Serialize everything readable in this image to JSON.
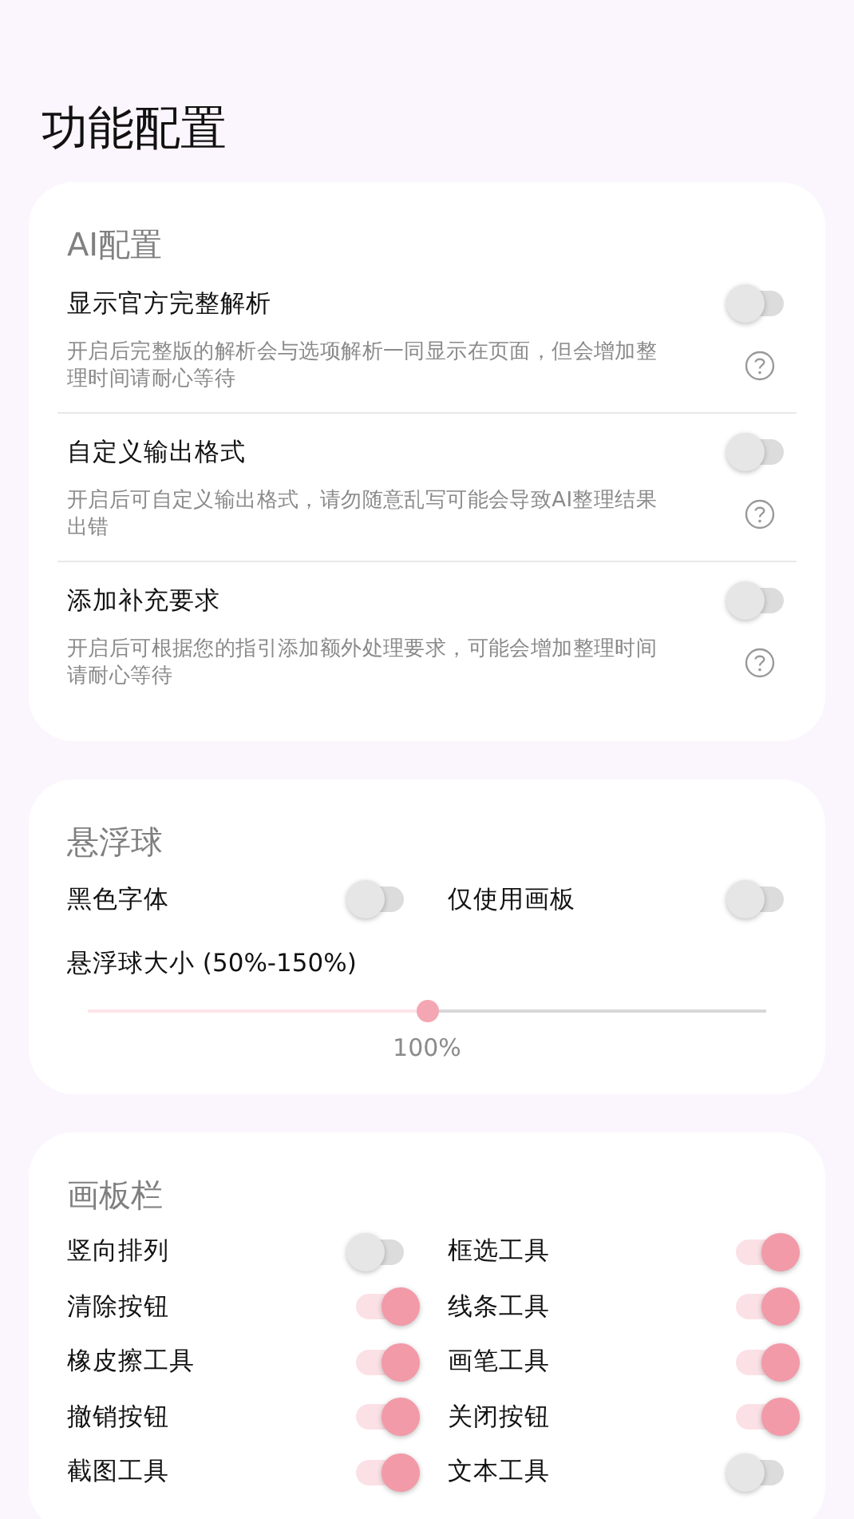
{
  "title": "功能配置",
  "sections": [
    {
      "kind": "list",
      "heading": "AI配置",
      "items": [
        {
          "label": "显示官方完整解析",
          "description": "开启后完整版的解析会与选项解析一同显示在页面，但会增加整理时间请耐心等待",
          "on": false
        },
        {
          "label": "自定义输出格式",
          "description": "开启后可自定义输出格式，请勿随意乱写可能会导致AI整理结果出错",
          "on": false
        },
        {
          "label": "添加补充要求",
          "description": "开启后可根据您的指引添加额外处理要求，可能会增加整理时间请耐心等待",
          "on": false
        }
      ]
    },
    {
      "kind": "grid",
      "heading": "悬浮球",
      "toggles": [
        {
          "label": "黑色字体",
          "on": false
        },
        {
          "label": "仅使用画板",
          "on": false
        }
      ],
      "slider": {
        "label": "悬浮球大小 (50%-150%)",
        "level": 0.5,
        "reading": "100%"
      }
    },
    {
      "kind": "grid",
      "heading": "画板栏",
      "toggles": [
        {
          "label": "竖向排列",
          "on": false
        },
        {
          "label": "框选工具",
          "on": true
        },
        {
          "label": "清除按钮",
          "on": true
        },
        {
          "label": "线条工具",
          "on": true
        },
        {
          "label": "橡皮擦工具",
          "on": true
        },
        {
          "label": "画笔工具",
          "on": true
        },
        {
          "label": "撤销按钮",
          "on": true
        },
        {
          "label": "关闭按钮",
          "on": true
        },
        {
          "label": "截图工具",
          "on": true
        },
        {
          "label": "文本工具",
          "on": false
        }
      ]
    }
  ]
}
